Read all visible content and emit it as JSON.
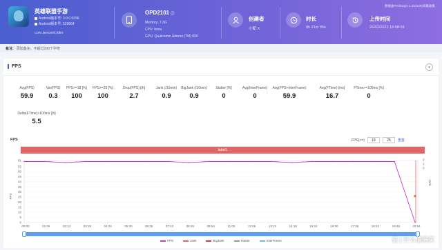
{
  "header": {
    "app_name": "英雄联盟手游",
    "android_version": "Android版本号: 3.0.0.5296",
    "android_build": "Android版本号: 529664",
    "package": "com.tencent.lolm",
    "device_name": "OPD2101",
    "memory": "Memory: 7.3G",
    "cpu": "CPU: kona",
    "gpu": "GPU: Qualcomm Adreno (TM) 650",
    "creator_title": "创建者",
    "creator_value": "小配 X",
    "duration_title": "时长",
    "duration_value": "0h 21m 55s",
    "upload_title": "上传时间",
    "upload_value": "26/02/2022 16:58:19",
    "report_link": "数据由PerfDog(v.1.220128)采集收集"
  },
  "remark": {
    "label": "备注:",
    "placeholder": "添加备注，不超过200个字符"
  },
  "section": {
    "title": "FPS",
    "collapse_label": "▾"
  },
  "metrics": [
    {
      "label": "Avg(FPS)",
      "value": "59.9"
    },
    {
      "label": "Var(FPS)",
      "value": "0.3"
    },
    {
      "label": "FPS>=18 [%]",
      "value": "100"
    },
    {
      "label": "FPS>=25 [%]",
      "value": "100"
    },
    {
      "label": "Drop(FPS) [/h]",
      "value": "2.7"
    },
    {
      "label": "Jank (/10min)",
      "value": "0.9"
    },
    {
      "label": "BigJank (/10min)",
      "value": "0.9"
    },
    {
      "label": "Stutter [%]",
      "value": "0"
    },
    {
      "label": "Avg(InterFrame)",
      "value": "0"
    },
    {
      "label": "Avg(FPS+InterFrame)",
      "value": "59.9"
    },
    {
      "label": "Avg(FTime) [ms]",
      "value": "16.7"
    },
    {
      "label": "FTime>=100ms [%]",
      "value": "0"
    },
    {
      "label": "Delta(FTime)>100ms [/h]",
      "value": "5.5"
    }
  ],
  "chart_header": {
    "title": "FPS",
    "range_label": "FPS(>=)",
    "range_a": "18",
    "range_b": "25",
    "reset": "重置",
    "band_label": "label1"
  },
  "chart_data": {
    "type": "line",
    "ylabel": "FPS",
    "y2label": "Jank",
    "y_ticks": [
      "61",
      "55",
      "50",
      "45",
      "40",
      "35",
      "30",
      "25",
      "20",
      "15",
      "10",
      "5",
      "0"
    ],
    "y2_ticks": [
      "2",
      "1",
      "0"
    ],
    "x_ticks": [
      "00:00",
      "01:06",
      "02:12",
      "03:18",
      "04:24",
      "05:30",
      "06:36",
      "07:42",
      "08:48",
      "09:54",
      "11:00",
      "12:06",
      "13:12",
      "14:18",
      "15:24",
      "16:30",
      "17:36",
      "18:42",
      "19:48",
      "20:54"
    ],
    "series": [
      {
        "name": "FPS",
        "color": "#c040c0",
        "values": [
          60,
          60,
          59,
          60,
          60,
          60,
          60,
          60,
          59,
          60,
          60,
          60,
          60,
          59,
          60,
          60,
          60,
          60,
          60,
          0
        ]
      },
      {
        "name": "Jank",
        "color": "#e06666"
      },
      {
        "name": "BigJank",
        "color": "#d04040"
      },
      {
        "name": "Stutter",
        "color": "#999999"
      },
      {
        "name": "InterFrame",
        "color": "#7ab4f0"
      }
    ],
    "ylim": [
      0,
      61
    ]
  },
  "watermark": "值 | 什么值得买"
}
